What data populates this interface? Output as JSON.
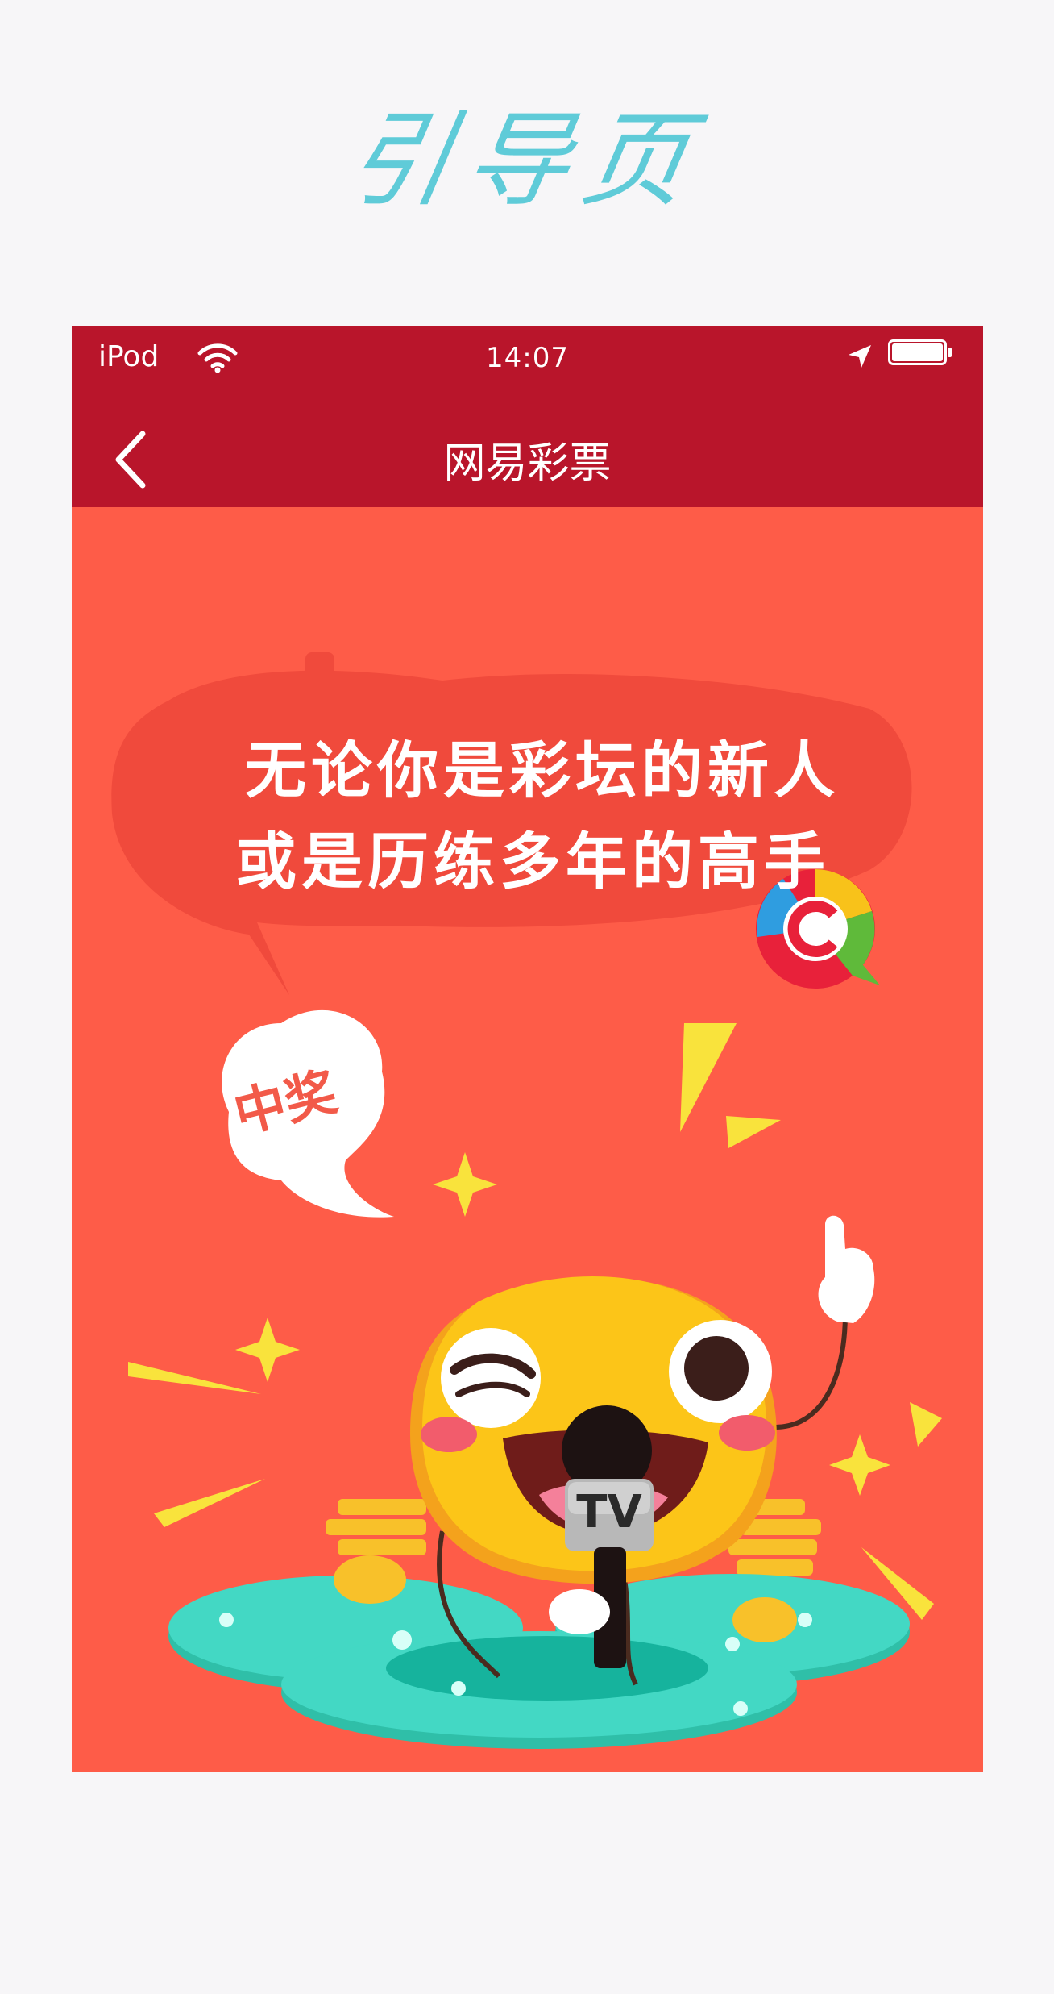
{
  "page": {
    "heading": "引导页"
  },
  "statusbar": {
    "carrier": "iPod",
    "time": "14:07"
  },
  "navbar": {
    "title": "网易彩票",
    "back_icon": "chevron-left-icon"
  },
  "hero": {
    "speech_line_1": "无论你是彩坛的新人",
    "speech_line_2": "或是历练多年的高手",
    "cloud_label": "中奖",
    "mic_label": "TV"
  },
  "colors": {
    "statusbar_bg": "#b9152b",
    "content_bg": "#fe5c48",
    "bubble": "#f04a3c",
    "mascot": "#fcc518",
    "platform": "#43d8c4",
    "spark": "#f9e33c",
    "heading": "#5fcbd8"
  },
  "scroll_hint_icon": "double-chevron-down-icon"
}
